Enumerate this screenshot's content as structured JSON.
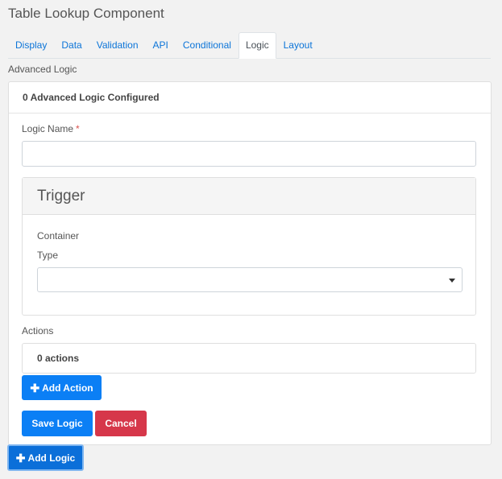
{
  "dialog": {
    "title": "Table Lookup Component"
  },
  "tabs": [
    {
      "label": "Display"
    },
    {
      "label": "Data"
    },
    {
      "label": "Validation"
    },
    {
      "label": "API"
    },
    {
      "label": "Conditional"
    },
    {
      "label": "Logic",
      "active": true
    },
    {
      "label": "Layout"
    }
  ],
  "section": {
    "label": "Advanced Logic"
  },
  "logic_card": {
    "header": "0 Advanced Logic Configured",
    "logic_name_label": "Logic Name",
    "logic_name_required_marker": "*",
    "logic_name_value": "",
    "trigger": {
      "title": "Trigger",
      "container_label": "Container",
      "type_label": "Type",
      "type_value": ""
    },
    "actions_label": "Actions",
    "actions_summary": "0 actions",
    "add_action_label": "Add Action",
    "save_logic_label": "Save Logic",
    "cancel_label": "Cancel"
  },
  "add_logic_label": "Add Logic",
  "icons": {
    "plus": "plus-icon",
    "caret": "caret-down-icon"
  },
  "colors": {
    "link": "#0b74d8",
    "primary": "#0b7ff5",
    "danger": "#d6374a",
    "required": "#d9534f"
  }
}
